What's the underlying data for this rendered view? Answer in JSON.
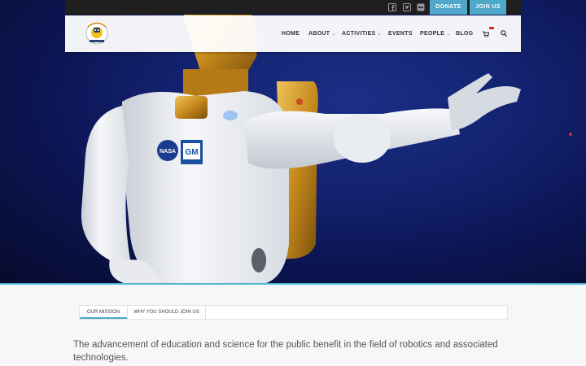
{
  "topbar": {
    "social_icons": [
      "facebook-icon",
      "twitter-icon",
      "flickr-icon"
    ],
    "donate_label": "DONATE",
    "join_label": "JOIN US",
    "accent": "#4fa8c9"
  },
  "nav": {
    "items": [
      {
        "label": "HOME",
        "has_caret": false
      },
      {
        "label": "ABOUT",
        "has_caret": true
      },
      {
        "label": "ACTIVITIES",
        "has_caret": true
      },
      {
        "label": "EVENTS",
        "has_caret": false
      },
      {
        "label": "PEOPLE",
        "has_caret": true
      },
      {
        "label": "BLOG",
        "has_caret": false
      }
    ],
    "caret": "⌄"
  },
  "tabs": [
    {
      "label": "OUR MISSION",
      "active": true
    },
    {
      "label": "WHY YOU SHOULD JOIN US",
      "active": false
    }
  ],
  "mission_text": "The advancement of education and science for the public benefit in the field of robotics and associated technologies.",
  "hero": {
    "nasa_label": "NASA",
    "gm_label": "GM"
  }
}
